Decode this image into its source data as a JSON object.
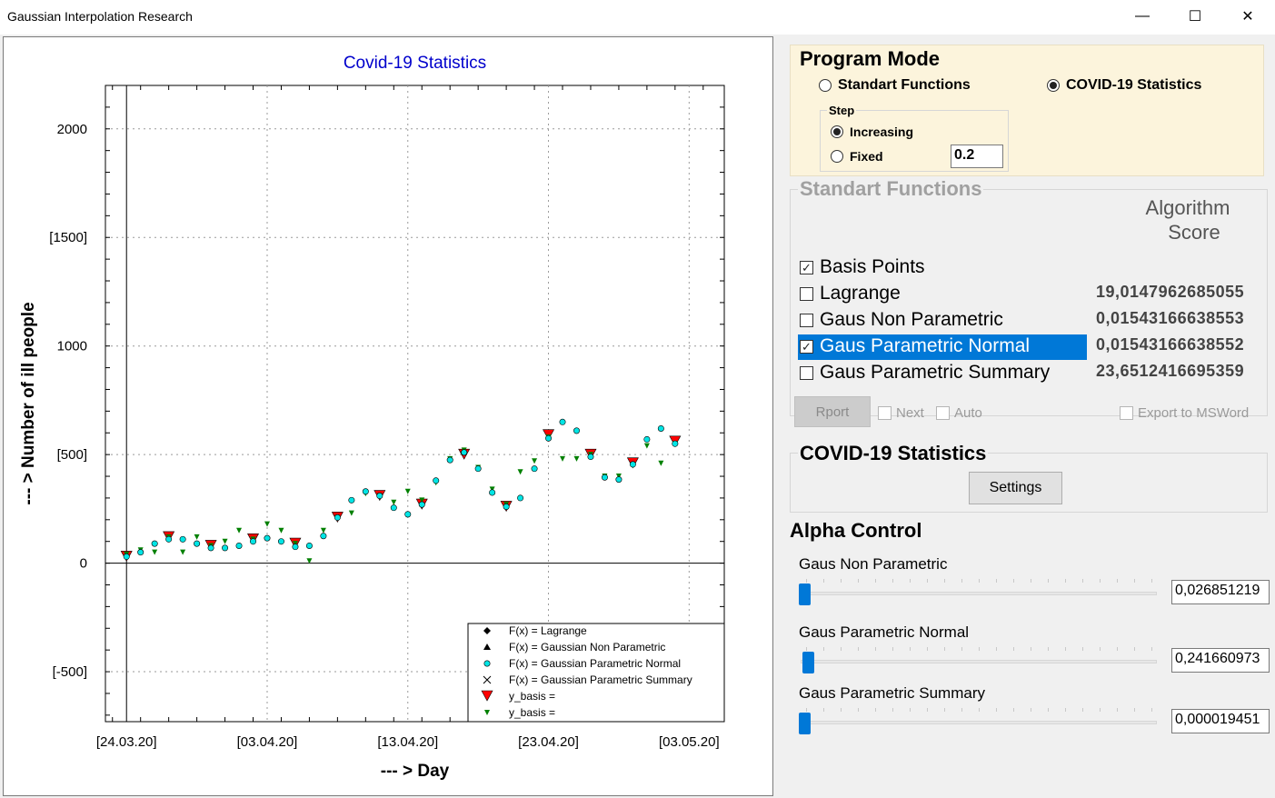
{
  "window": {
    "title": "Gaussian Interpolation Research",
    "minimize_glyph": "—",
    "maximize_glyph": "☐",
    "close_glyph": "✕"
  },
  "program_mode": {
    "title": "Program Mode",
    "options": [
      "Standart Functions",
      "COVID-19 Statistics"
    ],
    "selected": "COVID-19 Statistics",
    "step": {
      "title": "Step",
      "increasing_label": "Increasing",
      "fixed_label": "Fixed",
      "selected": "Increasing",
      "fixed_value": "0.2"
    },
    "bg_color": "#fcf4dc"
  },
  "standart_functions": {
    "title": "Standart Functions",
    "score_header_line1": "Algorithm",
    "score_header_line2": "Score",
    "items": [
      {
        "label": "Basis Points",
        "checked": true,
        "selected": false,
        "score": ""
      },
      {
        "label": "Lagrange",
        "checked": false,
        "selected": false,
        "score": "19,0147962685055"
      },
      {
        "label": "Gaus Non Parametric",
        "checked": false,
        "selected": false,
        "score": "0,01543166638553"
      },
      {
        "label": "Gaus Parametric Normal",
        "checked": true,
        "selected": true,
        "score": "0,01543166638552"
      },
      {
        "label": "Gaus Parametric Summary",
        "checked": false,
        "selected": false,
        "score": "23,6512416695359"
      }
    ],
    "report_button": "Rport",
    "next_label": "Next",
    "auto_label": "Auto",
    "export_label": "Export to MSWord",
    "selection_color": "#0078d7"
  },
  "covid": {
    "title": "COVID-19 Statistics",
    "settings_button": "Settings"
  },
  "alpha_control": {
    "title": "Alpha Control",
    "sliders": [
      {
        "label": "Gaus Non Parametric",
        "value": "0,026851219",
        "level": 0.0
      },
      {
        "label": "Gaus Parametric Normal",
        "value": "0,241660973",
        "level": 0.01
      },
      {
        "label": "Gaus Parametric Summary",
        "value": "0,000019451",
        "level": 0.0
      }
    ]
  },
  "chart_data": {
    "type": "scatter",
    "title": "Covid-19 Statistics",
    "xlabel": "--- > Day",
    "ylabel": "--- > Number of ill people",
    "x_tick_labels": [
      "[24.03.20]",
      "[03.04.20]",
      "[13.04.20]",
      "[23.04.20]",
      "[03.05.20]"
    ],
    "y_tick_labels": [
      "2000",
      "[1500]",
      "1000",
      "[500]",
      "0",
      "[-500]"
    ],
    "y_tick_values": [
      2000,
      1500,
      1000,
      500,
      0,
      -500
    ],
    "xlim": [
      -1.5,
      42.5
    ],
    "ylim": [
      -730,
      2200
    ],
    "grid": true,
    "legend_placement": "bottom-right",
    "legend": [
      {
        "label": "F(x) = Lagrange",
        "marker": "diamond"
      },
      {
        "label": "F(x) = Gaussian Non Parametric",
        "marker": "triangle"
      },
      {
        "label": "F(x) = Gaussian Parametric Normal",
        "marker": "cyan-circle"
      },
      {
        "label": "F(x) = Gaussian Parametric Summary",
        "marker": "cross"
      },
      {
        "label": "y_basis =",
        "marker": "red-triangle-down"
      },
      {
        "label": "y_basis =",
        "marker": "green-triangle-down"
      }
    ],
    "series": [
      {
        "marker": "red-triangle-down",
        "color": "#ff0000",
        "x": [
          0,
          3,
          6,
          9,
          12,
          15,
          18,
          21,
          24,
          27,
          30,
          33,
          36,
          39
        ],
        "y": [
          30,
          120,
          80,
          110,
          90,
          210,
          310,
          270,
          500,
          260,
          590,
          500,
          460,
          560
        ]
      },
      {
        "marker": "green-triangle-down",
        "color": "#008000",
        "x": [
          0,
          1,
          2,
          3,
          4,
          5,
          6,
          7,
          8,
          9,
          10,
          11,
          12,
          13,
          14,
          15,
          16,
          17,
          18,
          19,
          20,
          21,
          22,
          23,
          24,
          25,
          26,
          27,
          28,
          29,
          30,
          31,
          32,
          33,
          34,
          35,
          36,
          37,
          38,
          39
        ],
        "y": [
          40,
          60,
          50,
          120,
          50,
          120,
          80,
          100,
          150,
          110,
          180,
          150,
          90,
          10,
          150,
          210,
          230,
          320,
          310,
          280,
          330,
          290,
          370,
          480,
          520,
          440,
          340,
          270,
          420,
          470,
          580,
          480,
          480,
          500,
          400,
          400,
          450,
          540,
          460,
          550
        ]
      },
      {
        "marker": "cyan-circle",
        "color": "#00e5e5",
        "x": [
          0,
          1,
          2,
          3,
          4,
          5,
          6,
          7,
          8,
          9,
          10,
          11,
          12,
          13,
          14,
          15,
          16,
          17,
          18,
          19,
          20,
          21,
          22,
          23,
          24,
          25,
          26,
          27,
          28,
          29,
          30,
          31,
          32,
          33,
          34,
          35,
          36,
          37,
          38,
          39
        ],
        "y": [
          30,
          50,
          90,
          110,
          110,
          90,
          70,
          70,
          80,
          100,
          115,
          100,
          75,
          80,
          125,
          210,
          290,
          330,
          310,
          255,
          225,
          270,
          380,
          475,
          510,
          435,
          325,
          260,
          300,
          435,
          575,
          650,
          610,
          490,
          395,
          385,
          455,
          570,
          620,
          550
        ]
      }
    ]
  }
}
